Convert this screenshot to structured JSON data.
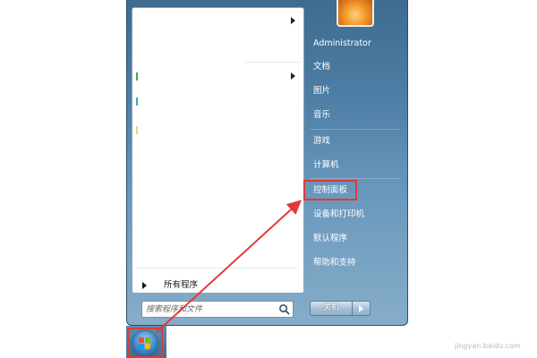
{
  "start_menu": {
    "user": "Administrator",
    "right_items": [
      {
        "id": "documents",
        "label": "文档"
      },
      {
        "id": "pictures",
        "label": "图片"
      },
      {
        "id": "music",
        "label": "音乐"
      },
      {
        "id": "games",
        "label": "游戏"
      },
      {
        "id": "computer",
        "label": "计算机"
      },
      {
        "id": "control_panel",
        "label": "控制面板"
      },
      {
        "id": "devices_printers",
        "label": "设备和打印机"
      },
      {
        "id": "default_programs",
        "label": "默认程序"
      },
      {
        "id": "help_support",
        "label": "帮助和支持"
      }
    ],
    "all_programs": "所有程序",
    "search": {
      "placeholder": "搜索程序和文件"
    },
    "shutdown_label": "关机"
  },
  "annotation": {
    "color": "#e03a3a"
  },
  "watermark": "jingyan.baidu.com"
}
